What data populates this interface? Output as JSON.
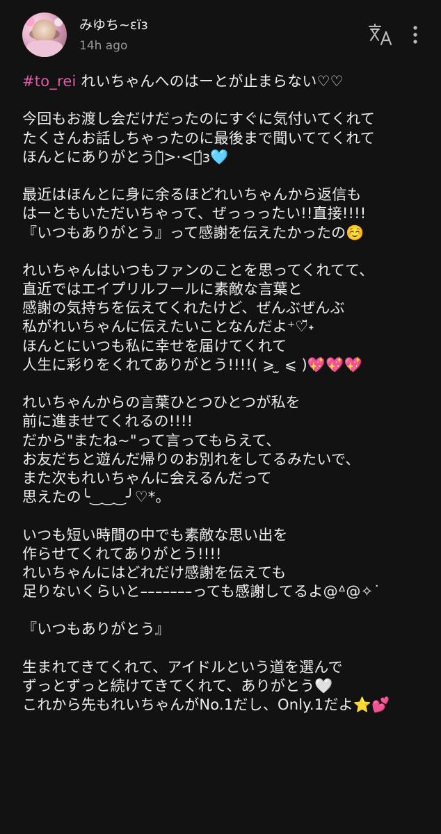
{
  "post": {
    "username": "みゆち~ɛïɜ",
    "timestamp": "14h ago",
    "hashtag": "#to_rei",
    "first_line_rest": " れいちゃんへのはーとが止まらない♡♡",
    "lines": [
      "",
      "今回もお渡し会だけだったのにすぐに気付いてくれて",
      "たくさんお話しちゃったのに最後まで聞いててくれて",
      "ほんとにありがとうꒉ̀>·<ꒉ́ɜ🩵",
      "",
      "最近はほんとに身に余るほどれいちゃんから返信も",
      "はーともいただいちゃって、ぜっっったい!!直接!!!!",
      "『いつもありがとう』って感謝を伝えたかったの☺️",
      "",
      "れいちゃんはいつもファンのことを思ってくれてて、",
      "直近ではエイプリルフールに素敵な言葉と",
      "感謝の気持ちを伝えてくれたけど、ぜんぶぜんぶ",
      "私がれいちゃんに伝えたいことなんだよ⁺♡̆̈˖",
      "ほんとにいつも私に幸せを届けてくれて",
      "人生に彩りをくれてありがとう!!!!( ⩾ ̫ ⩽ )💖💖💖",
      "",
      "れいちゃんからの言葉ひとつひとつが私を",
      "前に進ませてくれるの!!!!",
      "だから\"またね~\"って言ってもらえて、",
      "お友だちと遊んだ帰りのお別れをしてるみたいで、",
      "また次もれいちゃんに会えるんだって",
      "思えたの╰‿‿‿╯♡*。",
      "",
      "いつも短い時間の中でも素敵な思い出を",
      "作らせてくれてありがとう!!!!",
      "れいちゃんにはどれだけ感謝を伝えても",
      "足りないくらいと–––––––っても感謝してるよ@ᐞ@✧˙",
      "",
      "『いつもありがとう』",
      "",
      "生まれてきてくれて、アイドルという道を選んで",
      "ずっとずっと続けてきてくれて、ありがとう🤍",
      "これから先もれいちゃんがNo.1だし、Only.1だよ⭐💕"
    ]
  },
  "icons": {
    "translate": "translate-icon",
    "more": "more-vertical-icon"
  },
  "colors": {
    "background": "#121212",
    "text": "#ececec",
    "muted": "#9a9a9a",
    "hashtag": "#e35aa6"
  }
}
